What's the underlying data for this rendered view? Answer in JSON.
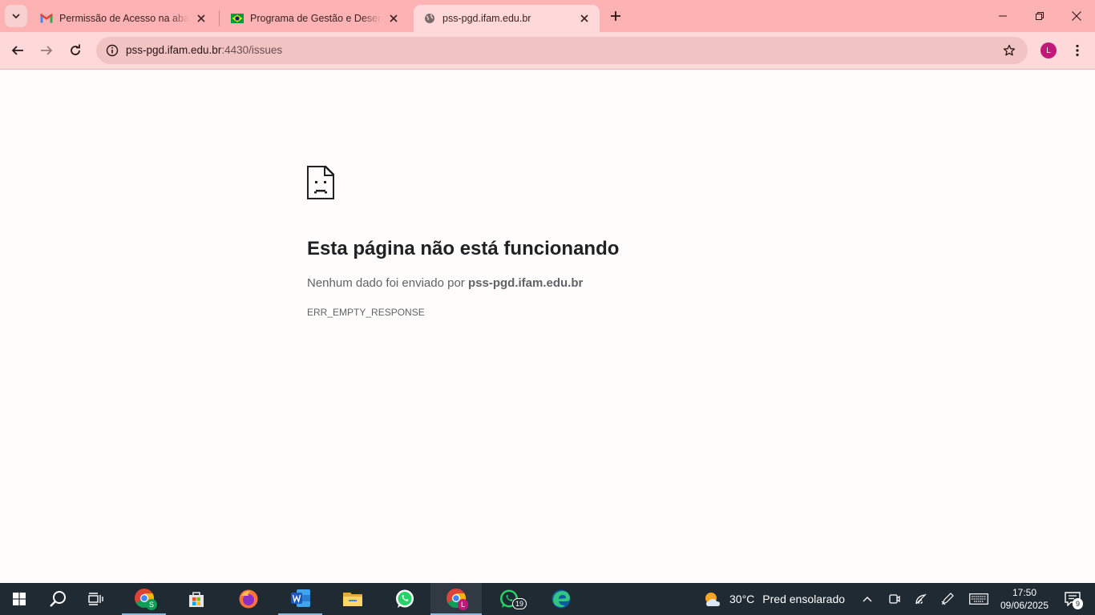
{
  "browser": {
    "tabs": [
      {
        "title": "Permissão de Acesso na aba pa",
        "favicon": "gmail-icon",
        "active": false
      },
      {
        "title": "Programa de Gestão e Desempe",
        "favicon": "brazil-flag-icon",
        "active": false
      },
      {
        "title": "pss-pgd.ifam.edu.br",
        "favicon": "globe-icon",
        "active": true
      }
    ],
    "address_bar": {
      "host": "pss-pgd.ifam.edu.br",
      "path": ":4430/issues"
    },
    "profile_initial": "L",
    "accent_color": "#fdb3b3"
  },
  "error_page": {
    "title": "Esta página não está funcionando",
    "description_prefix": "Nenhum dado foi enviado por ",
    "description_host": "pss-pgd.ifam.edu.br",
    "error_code": "ERR_EMPTY_RESPONSE"
  },
  "taskbar": {
    "apps": [
      {
        "name": "chrome-profile-s",
        "badge": "S"
      },
      {
        "name": "microsoft-store"
      },
      {
        "name": "firefox"
      },
      {
        "name": "word"
      },
      {
        "name": "file-explorer"
      },
      {
        "name": "whatsapp"
      },
      {
        "name": "chrome-profile-l",
        "badge": "L",
        "active": true
      },
      {
        "name": "whatsapp-business",
        "badge": "19"
      },
      {
        "name": "edge"
      }
    ],
    "weather": {
      "temp": "30°C",
      "condition": "Pred ensolarado"
    },
    "clock": {
      "time": "17:50",
      "date": "09/06/2025"
    },
    "notifications": "9"
  }
}
